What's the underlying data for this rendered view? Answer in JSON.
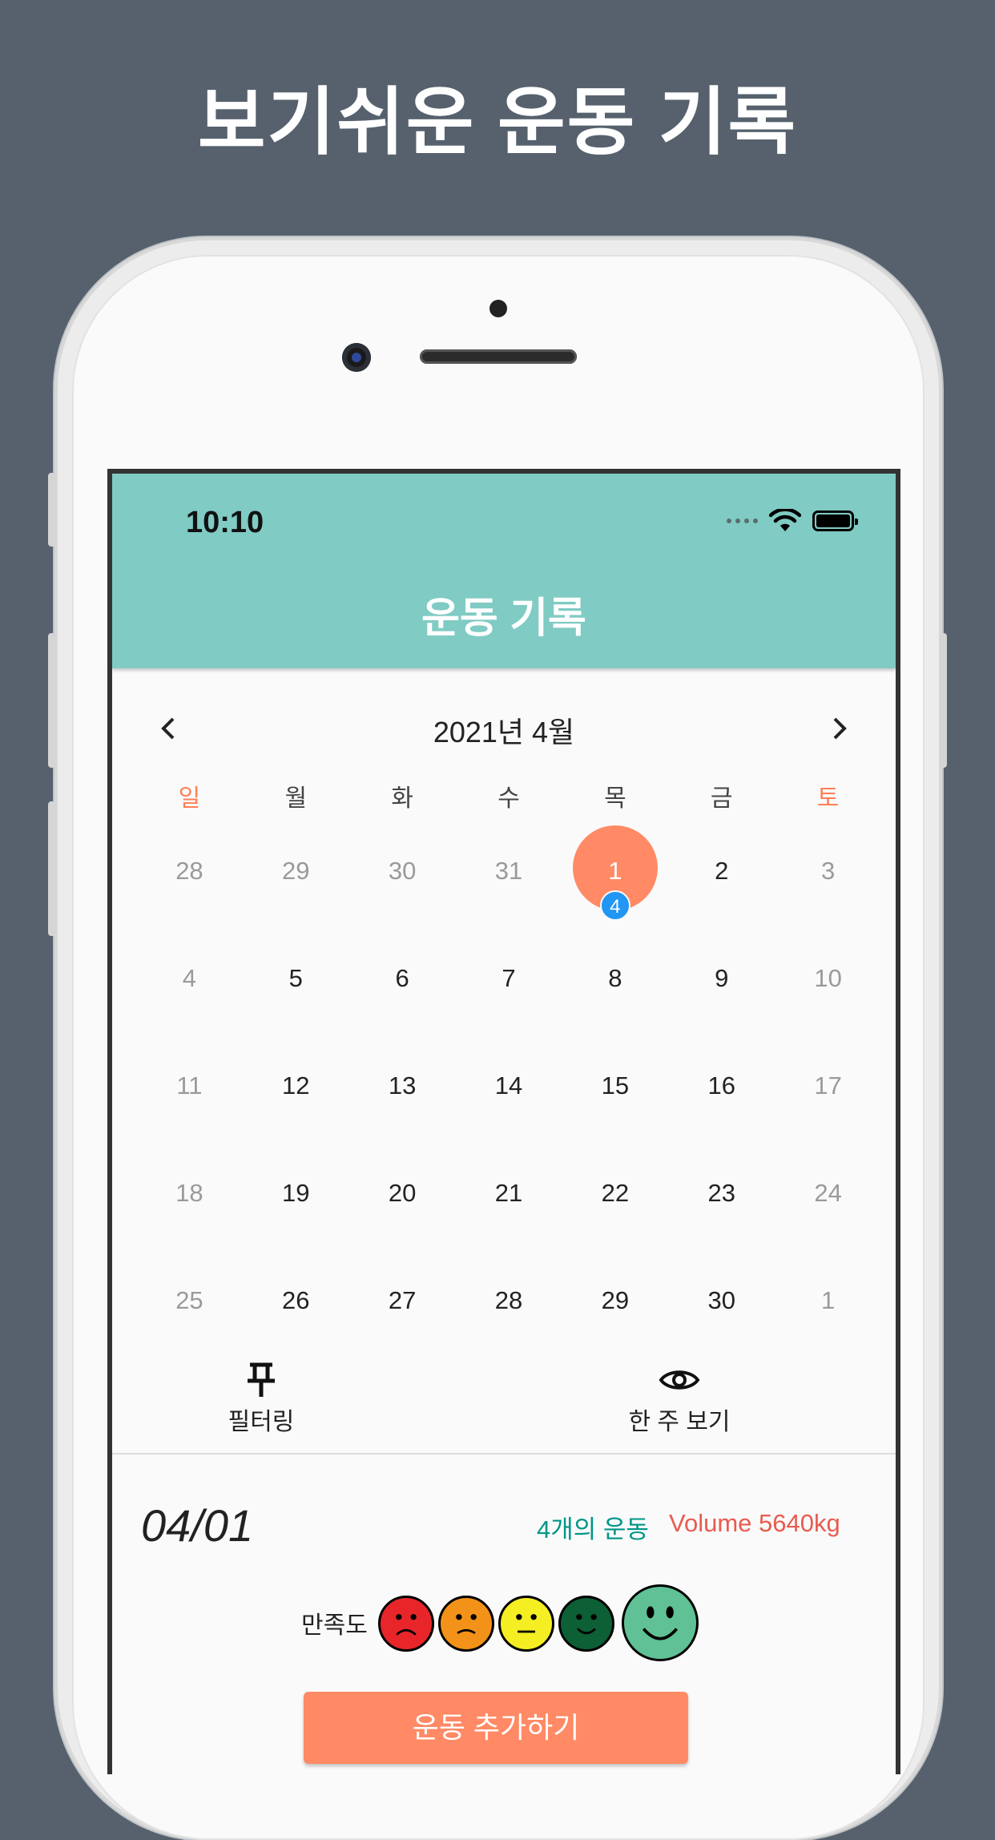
{
  "headline": "보기쉬운 운동 기록",
  "status": {
    "time": "10:10"
  },
  "appbar": {
    "title": "운동 기록"
  },
  "calendar": {
    "month_label": "2021년 4월",
    "weekdays": [
      "일",
      "월",
      "화",
      "수",
      "목",
      "금",
      "토"
    ],
    "weeks": [
      [
        "28",
        "29",
        "30",
        "31",
        "1",
        "2",
        "3"
      ],
      [
        "4",
        "5",
        "6",
        "7",
        "8",
        "9",
        "10"
      ],
      [
        "11",
        "12",
        "13",
        "14",
        "15",
        "16",
        "17"
      ],
      [
        "18",
        "19",
        "20",
        "21",
        "22",
        "23",
        "24"
      ],
      [
        "25",
        "26",
        "27",
        "28",
        "29",
        "30",
        "1"
      ]
    ],
    "selected_badge": "4"
  },
  "toolbar": {
    "filter_label": "필터링",
    "week_view_label": "한 주 보기"
  },
  "detail": {
    "date": "04/01",
    "exercise_count": "4개의 운동",
    "volume": "Volume 5640kg",
    "satisfaction_label": "만족도",
    "selected_satisfaction": 5
  },
  "add_button": "운동 추가하기",
  "colors": {
    "appbar": "#80cbc4",
    "accent": "#ff8a65",
    "badge": "#2196f3",
    "count": "#009688",
    "volume": "#e95b50"
  }
}
